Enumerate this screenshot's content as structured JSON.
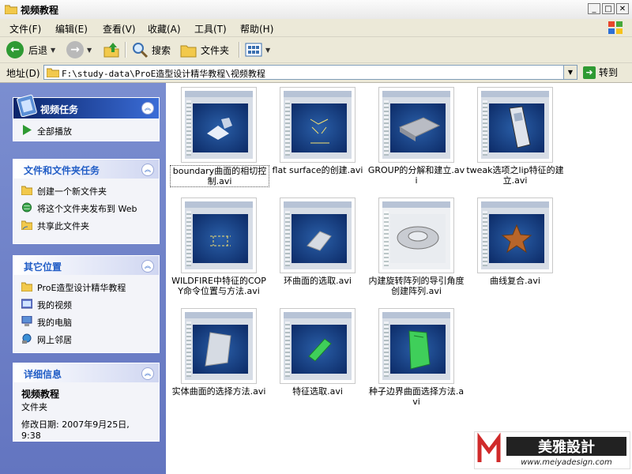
{
  "window": {
    "title": "视频教程"
  },
  "menu": [
    "文件(F)",
    "编辑(E)",
    "查看(V)",
    "收藏(A)",
    "工具(T)",
    "帮助(H)"
  ],
  "toolbar": {
    "back_label": "后退",
    "search_label": "搜索",
    "folders_label": "文件夹"
  },
  "address": {
    "label": "地址(D)",
    "path": "F:\\study-data\\ProE造型设计精华教程\\视频教程",
    "go_label": "转到"
  },
  "tasks": {
    "video": {
      "title": "视频任务",
      "items": [
        "全部播放"
      ]
    },
    "folder": {
      "title": "文件和文件夹任务",
      "items": [
        "创建一个新文件夹",
        "将这个文件夹发布到 Web",
        "共享此文件夹"
      ]
    },
    "places": {
      "title": "其它位置",
      "items": [
        "ProE造型设计精华教程",
        "我的视频",
        "我的电脑",
        "网上邻居"
      ]
    },
    "details": {
      "title": "详细信息",
      "name": "视频教程",
      "type": "文件夹",
      "modified": "修改日期: 2007年9月25日, 9:38"
    }
  },
  "files": [
    "boundary曲面的相切控制.avi",
    "flat surface的创建.avi",
    "GROUP的分解和建立.avi",
    "tweak选项之lip特征的建立.avi",
    "WILDFIRE中特征的COPY命令位置与方法.avi",
    "环曲面的选取.avi",
    "内建旋转阵列的导引角度创建阵列.avi",
    "曲线复合.avi",
    "实体曲面的选择方法.avi",
    "特征选取.avi",
    "种子边界曲面选择方法.avi"
  ],
  "watermark": {
    "brand": "美雅設計",
    "url": "www.meiyadesign.com"
  }
}
